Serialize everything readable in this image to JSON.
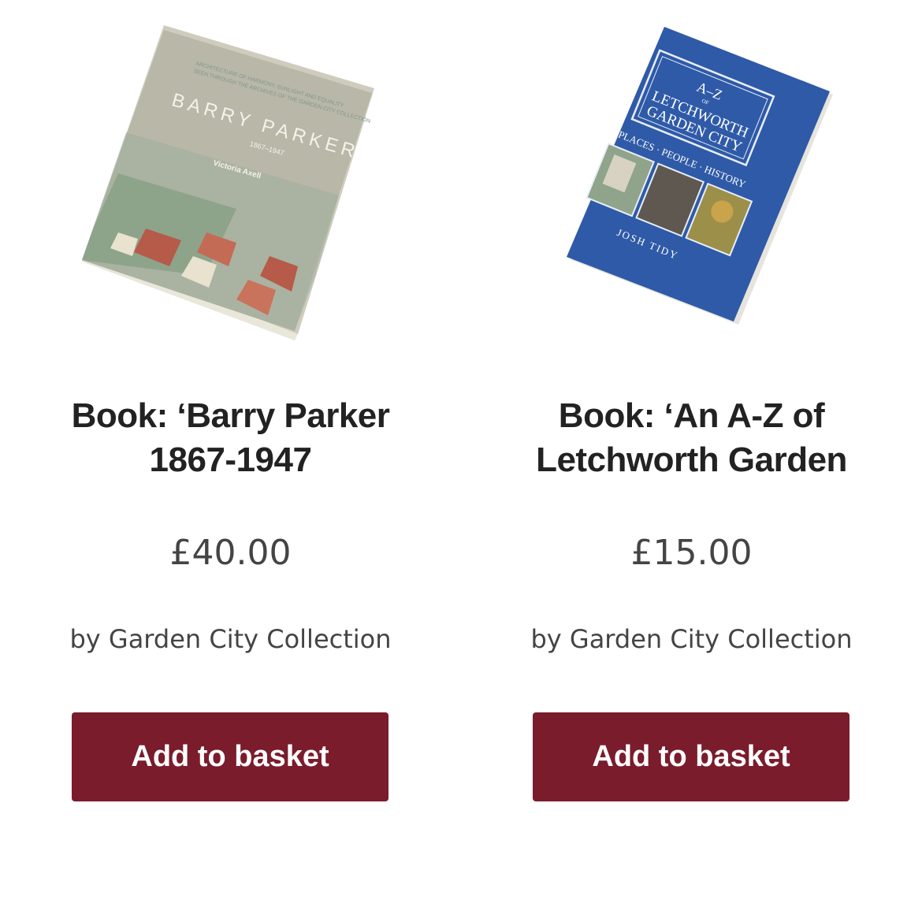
{
  "products": [
    {
      "cover": {
        "series": "ARCHITECTURE OF HARMONY, SUNLIGHT AND EQUALITY",
        "subtitle": "SEEN THROUGH THE ARCHIVES OF THE GARDEN CITY COLLECTION",
        "title": "BARRY PARKER",
        "dates": "1867–1947",
        "author": "Victoria Axell",
        "color": "#b9b7a7"
      },
      "title_line1": "Book: ‘Barry Parker",
      "title_line2": "1867-1947",
      "price": "£40.00",
      "vendor": "by Garden City Collection",
      "button_label": "Add to basket"
    },
    {
      "cover": {
        "title_line1": "A–Z",
        "title_of": "OF",
        "title_line2": "LETCHWORTH",
        "title_line3": "GARDEN CITY",
        "tagline": "PLACES · PEOPLE · HISTORY",
        "author": "JOSH TIDY",
        "color": "#2f5aa8"
      },
      "title_line1": "Book: ‘An A-Z of",
      "title_line2": "Letchworth Garden",
      "price": "£15.00",
      "vendor": "by Garden City Collection",
      "button_label": "Add to basket"
    }
  ],
  "colors": {
    "button": "#7a1c2c",
    "button_text": "#ffffff"
  }
}
